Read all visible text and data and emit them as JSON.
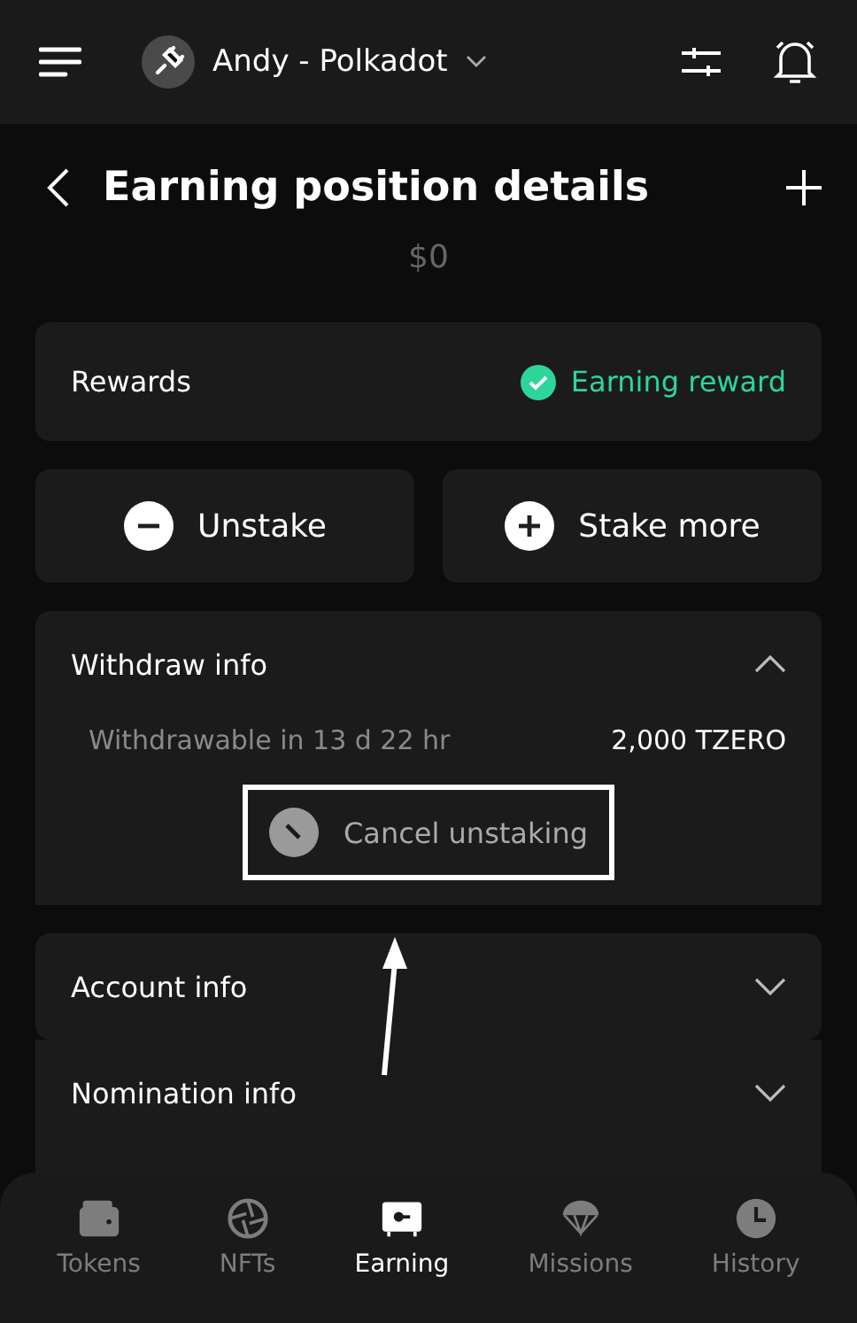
{
  "top_bar": {
    "account": "Andy - Polkadot"
  },
  "header": {
    "title": "Earning position details"
  },
  "balance": "$0",
  "rewards": {
    "label": "Rewards",
    "status": "Earning reward"
  },
  "actions": [
    {
      "label": "Unstake",
      "kind": "minus"
    },
    {
      "label": "Stake more",
      "kind": "plus"
    }
  ],
  "sections": [
    {
      "title": "Withdraw info",
      "expanded": true,
      "row": {
        "label": "Withdrawable in 13 d 22 hr",
        "value": "2,000 TZERO"
      },
      "button": "Cancel unstaking"
    },
    {
      "title": "Account info",
      "expanded": false
    },
    {
      "title": "Nomination info",
      "expanded": false
    }
  ],
  "tabs": [
    {
      "label": "Tokens",
      "kind": "wallet",
      "selected": false
    },
    {
      "label": "NFTs",
      "kind": "aperture",
      "selected": false
    },
    {
      "label": "Earning",
      "kind": "safe",
      "selected": true
    },
    {
      "label": "Missions",
      "kind": "parachute",
      "selected": false
    },
    {
      "label": "History",
      "kind": "clock",
      "selected": false
    }
  ]
}
